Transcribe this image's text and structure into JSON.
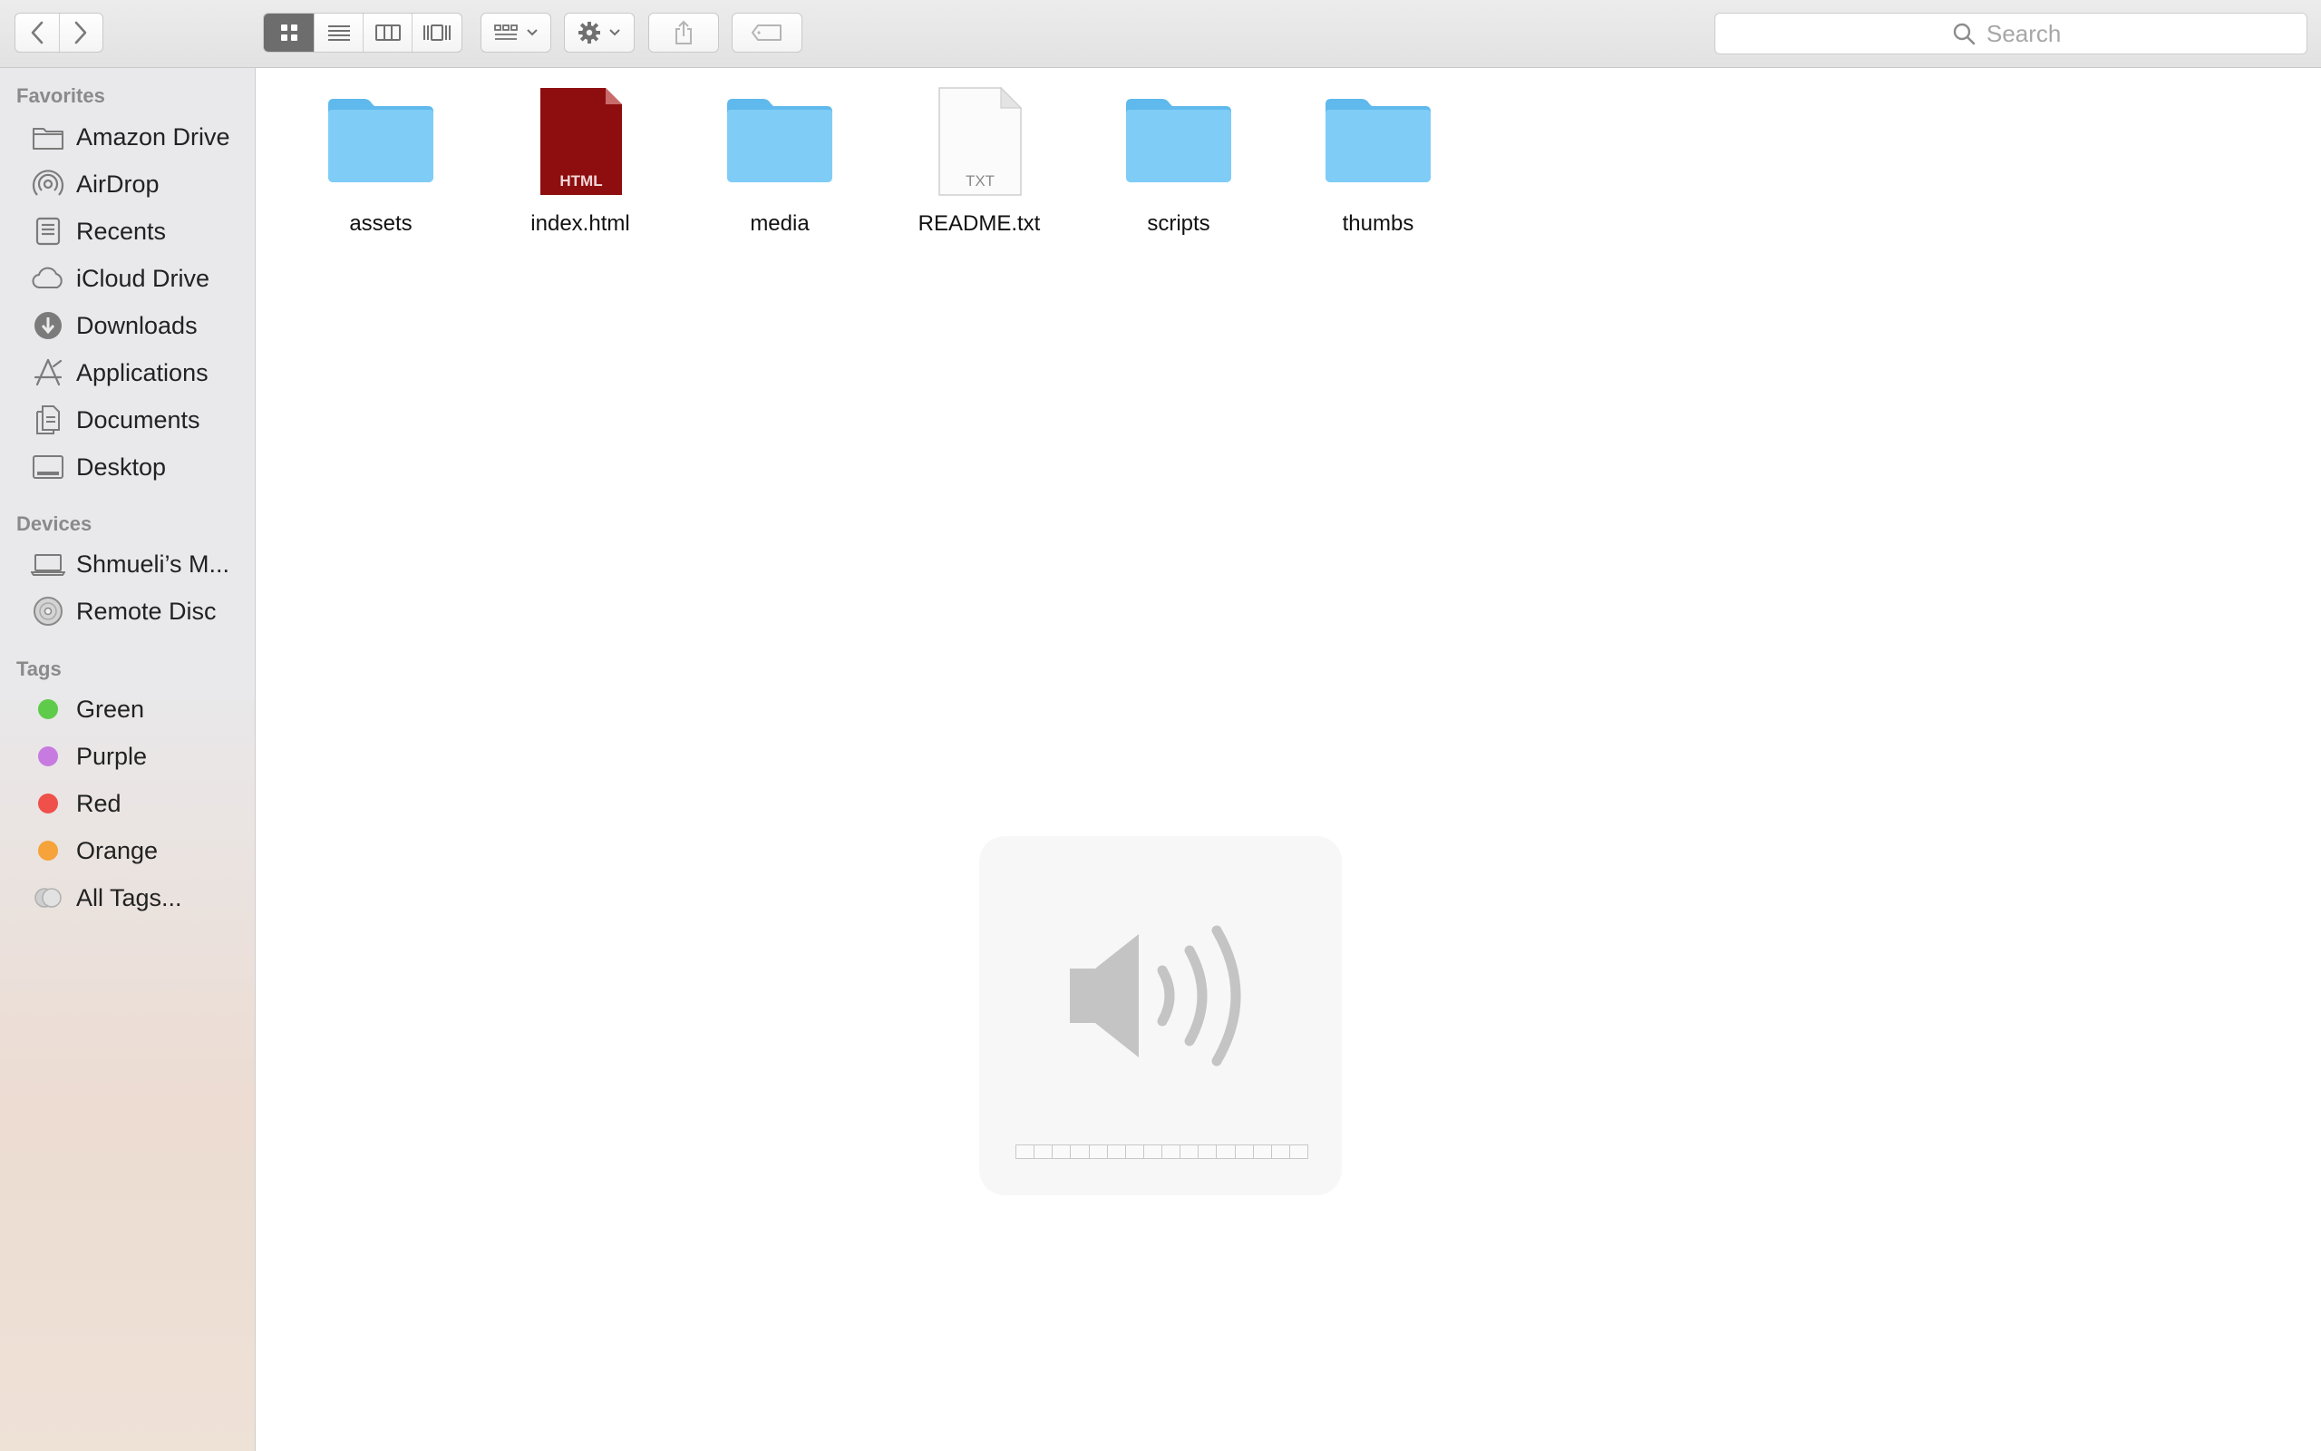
{
  "toolbar": {
    "back_icon": "chevron-left-icon",
    "forward_icon": "chevron-right-icon",
    "view_modes": [
      "icon-view",
      "list-view",
      "column-view",
      "cover-flow-view"
    ],
    "active_view": "icon-view",
    "search_placeholder": "Search"
  },
  "sidebar": {
    "favorites_header": "Favorites",
    "favorites": [
      {
        "label": "Amazon Drive",
        "icon": "folder-icon"
      },
      {
        "label": "AirDrop",
        "icon": "airdrop-icon"
      },
      {
        "label": "Recents",
        "icon": "recents-icon"
      },
      {
        "label": "iCloud Drive",
        "icon": "cloud-icon"
      },
      {
        "label": "Downloads",
        "icon": "download-icon"
      },
      {
        "label": "Applications",
        "icon": "applications-icon"
      },
      {
        "label": "Documents",
        "icon": "documents-icon"
      },
      {
        "label": "Desktop",
        "icon": "desktop-icon"
      }
    ],
    "devices_header": "Devices",
    "devices": [
      {
        "label": "Shmueli’s M...",
        "icon": "laptop-icon"
      },
      {
        "label": "Remote Disc",
        "icon": "disc-icon"
      }
    ],
    "tags_header": "Tags",
    "tags": [
      {
        "label": "Green",
        "color": "#5fcb4a"
      },
      {
        "label": "Purple",
        "color": "#c77be0"
      },
      {
        "label": "Red",
        "color": "#f0504a"
      },
      {
        "label": "Orange",
        "color": "#f5a33a"
      },
      {
        "label": "All Tags...",
        "color": "#c8c8c8"
      }
    ]
  },
  "files": [
    {
      "name": "assets",
      "type": "folder"
    },
    {
      "name": "index.html",
      "type": "html",
      "badge": "HTML"
    },
    {
      "name": "media",
      "type": "folder"
    },
    {
      "name": "README.txt",
      "type": "txt",
      "badge": "TXT"
    },
    {
      "name": "scripts",
      "type": "folder"
    },
    {
      "name": "thumbs",
      "type": "folder"
    }
  ],
  "volume_hud": {
    "icon": "speaker-icon",
    "level": 0,
    "segments": 16
  },
  "colors": {
    "folder": "#7fcdf6",
    "html_file": "#8e0e10",
    "active_view": "#6d6d6d"
  }
}
